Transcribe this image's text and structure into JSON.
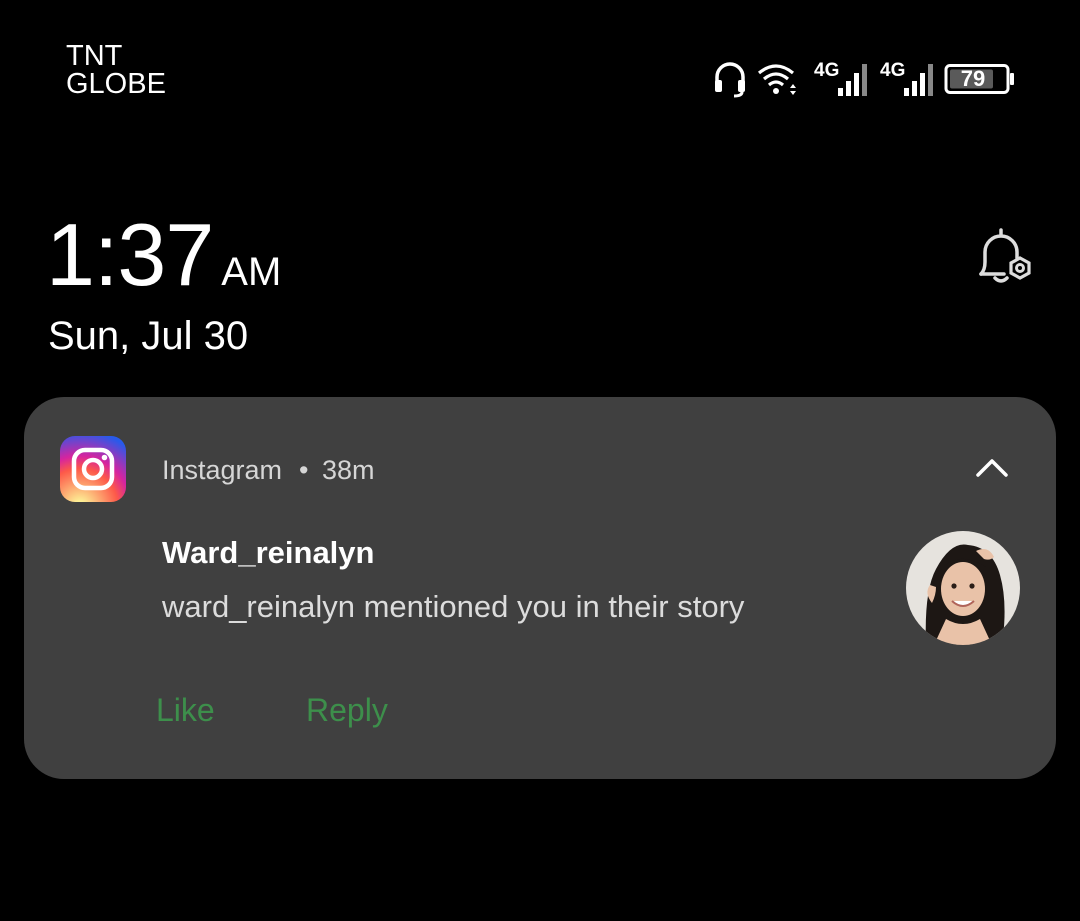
{
  "status_bar": {
    "carrier_1": "TNT",
    "carrier_2": "GLOBE",
    "network_1": "4G",
    "network_2": "4G",
    "battery_level": "79",
    "icons": [
      "headset-icon",
      "wifi-icon",
      "signal-icon",
      "signal-icon",
      "battery-icon"
    ]
  },
  "lockscreen": {
    "time": "1:37",
    "ampm": "AM",
    "date": "Sun, Jul 30",
    "notification_settings_icon": "bell-settings-icon"
  },
  "notification": {
    "app_name": "Instagram",
    "separator": "•",
    "time_ago": "38m",
    "sender": "Ward_reinalyn",
    "message": "ward_reinalyn mentioned you in their story",
    "actions": {
      "like": "Like",
      "reply": "Reply"
    },
    "app_icon": "instagram-icon",
    "collapse_icon": "chevron-up-icon"
  },
  "colors": {
    "background": "#000000",
    "card": "#404040",
    "action": "#3d8f4b",
    "secondary_text": "#d6d6d6"
  }
}
